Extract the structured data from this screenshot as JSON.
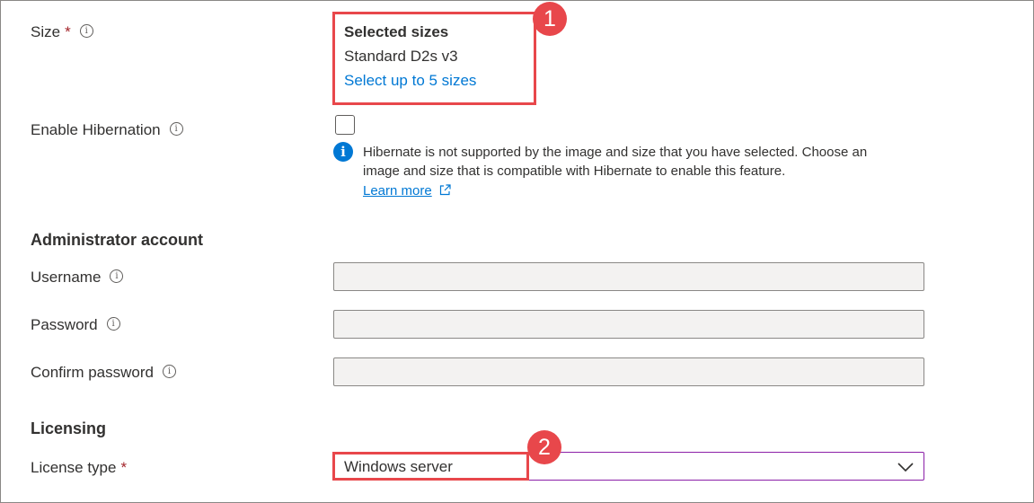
{
  "size": {
    "label": "Size",
    "required_mark": "*",
    "info_glyph": "i",
    "selected_title": "Selected sizes",
    "selected_value": "Standard D2s v3",
    "select_link": "Select up to 5 sizes",
    "callout_number": "1"
  },
  "hibernation": {
    "label": "Enable Hibernation",
    "info_glyph": "i",
    "checked": false,
    "message_line1": "Hibernate is not supported by the image and size that you have selected. Choose an",
    "message_line2": "image and size that is compatible with Hibernate to enable this feature.",
    "learn_more": "Learn more",
    "message_icon_glyph": "i"
  },
  "admin": {
    "title": "Administrator account",
    "username_label": "Username",
    "password_label": "Password",
    "confirm_label": "Confirm password",
    "info_glyph": "i",
    "username_value": "",
    "password_value": "",
    "confirm_value": ""
  },
  "licensing": {
    "title": "Licensing",
    "license_label": "License type",
    "required_mark": "*",
    "license_value": "Windows server",
    "callout_number": "2"
  },
  "colors": {
    "accent": "#0078d4",
    "callout": "#e8474b",
    "required": "#a4262c",
    "dropdown_border": "#8b1fa8"
  }
}
